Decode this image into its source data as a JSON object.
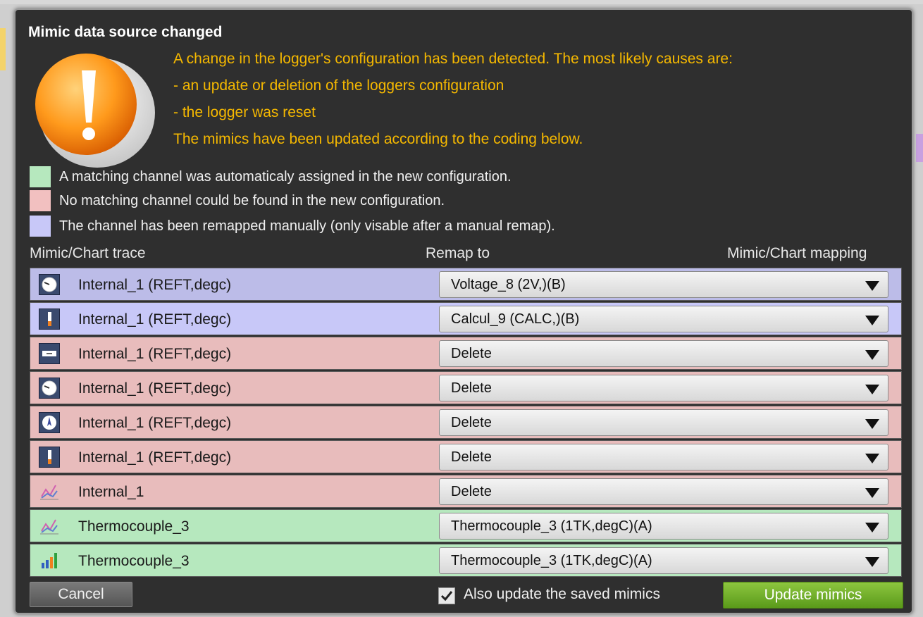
{
  "dialog": {
    "title": "Mimic data source changed",
    "message_lines": [
      "A change in the logger's configuration has been detected. The most likely causes are:",
      "- an update or deletion of the loggers configuration",
      "- the logger was reset",
      "The mimics have been updated according to the coding below."
    ],
    "legend": [
      {
        "color": "#b6e8be",
        "text": "A matching channel was automaticaly assigned in the new configuration."
      },
      {
        "color": "#f2c0c0",
        "text": "No matching channel could be found in the new configuration."
      },
      {
        "color": "#c8c8f8",
        "text": "The channel has been remapped manually (only visable after a manual remap)."
      }
    ],
    "columns": {
      "trace": "Mimic/Chart trace",
      "remap": "Remap to",
      "mapping": "Mimic/Chart mapping"
    },
    "rows": [
      {
        "icon": "gauge-icon",
        "label": "Internal_1 (REFT,degc)",
        "value": "Voltage_8 (2V,)(B)",
        "status": "manual",
        "color": "#bcbce8"
      },
      {
        "icon": "thermometer-icon",
        "label": "Internal_1 (REFT,degc)",
        "value": "Calcul_9 (CALC,)(B)",
        "status": "manual",
        "color": "#c8c8f8"
      },
      {
        "icon": "digital-display-icon",
        "label": "Internal_1 (REFT,degc)",
        "value": "Delete",
        "status": "none",
        "color": "#e8bcbc"
      },
      {
        "icon": "gauge-icon",
        "label": "Internal_1 (REFT,degc)",
        "value": "Delete",
        "status": "none",
        "color": "#e8bcbc"
      },
      {
        "icon": "compass-icon",
        "label": "Internal_1 (REFT,degc)",
        "value": "Delete",
        "status": "none",
        "color": "#e8bcbc"
      },
      {
        "icon": "thermometer-icon",
        "label": "Internal_1 (REFT,degc)",
        "value": "Delete",
        "status": "none",
        "color": "#e8bcbc"
      },
      {
        "icon": "line-chart-icon",
        "label": "Internal_1",
        "value": "Delete",
        "status": "none",
        "color": "#e8bcbc"
      },
      {
        "icon": "line-chart-icon",
        "label": "Thermocouple_3",
        "value": "Thermocouple_3 (1TK,degC)(A)",
        "status": "matched",
        "color": "#b6e8be"
      },
      {
        "icon": "bar-chart-icon",
        "label": "Thermocouple_3",
        "value": "Thermocouple_3 (1TK,degC)(A)",
        "status": "matched",
        "color": "#b6e8be"
      }
    ],
    "footer": {
      "cancel_label": "Cancel",
      "checkbox_label": "Also update the saved mimics",
      "checkbox_checked": true,
      "update_label": "Update mimics"
    }
  }
}
